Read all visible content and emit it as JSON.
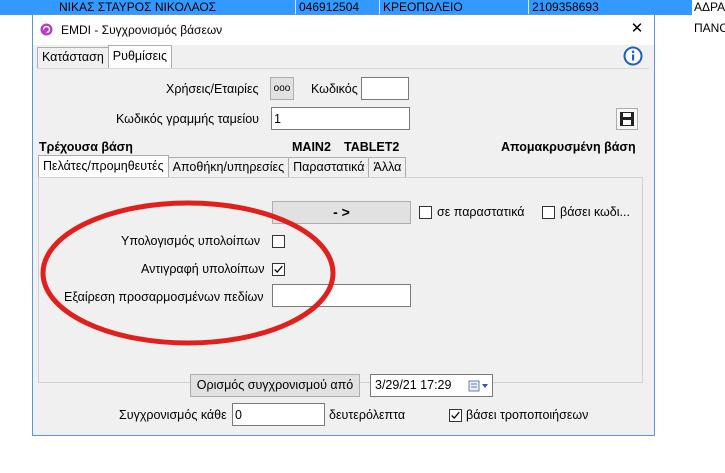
{
  "background": {
    "row_name": "ΝΙΚΑΣ ΣΤΑΥΡΟΣ ΝΙΚΟΛΑΟΣ",
    "row_phone1": "046912504",
    "row_category": "ΚΡΕΟΠΩΛΕΙΟ",
    "row_phone2": "2109358693",
    "right_col1": "ΑΔΡΑ",
    "right_col2": "ΠΑΝΟ"
  },
  "dialog": {
    "title": "EMDI - Συγχρονισμός βάσεων",
    "tabs": [
      "Κατάσταση",
      "Ρυθμίσεις"
    ],
    "active_tab": "Ρυθμίσεις"
  },
  "settings": {
    "uses_companies_label": "Χρήσεις/Εταιρίες",
    "ellipsis_button": "ooo",
    "code_label": "Κωδικός",
    "code_value": "",
    "cashline_label": "Κωδικός γραμμής ταμείου",
    "cashline_value": "1",
    "current_db_label": "Τρέχουσα βάση",
    "db_main": "MAIN2",
    "db_tablet": "TABLET2",
    "remote_db_label": "Απομακρυσμένη βάση"
  },
  "inner_tabs": [
    "Πελάτες/προμηθευτές",
    "Αποθήκη/υπηρεσίες",
    "Παραστατικά",
    "Άλλα"
  ],
  "inner_active_tab": "Πελάτες/προμηθευτές",
  "customers_tab": {
    "direction_button": "-  >",
    "in_documents_label": "σε παραστατικά",
    "in_documents_checked": false,
    "by_code_label": "βάσει κωδι...",
    "by_code_checked": false,
    "calc_balances_label": "Υπολογισμός υπολοίπων",
    "calc_balances_checked": false,
    "copy_balances_label": "Αντιγραφή υπολοίπων",
    "copy_balances_checked": true,
    "exclude_custom_label": "Εξαίρεση προσαρμοσμένων πεδίων",
    "exclude_custom_value": ""
  },
  "sync": {
    "define_button": "Ορισμός συγχρονισμού από",
    "datetime_value": "3/29/21 17:29",
    "every_label": "Συγχρονισμός κάθε",
    "every_value": "0",
    "seconds_label": "δευτερόλεπτα",
    "by_changes_label": "βάσει τροποποιήσεων",
    "by_changes_checked": true
  },
  "colors": {
    "selection": "#3399ff",
    "annotation": "#e0201c",
    "info": "#1f5fbf"
  }
}
